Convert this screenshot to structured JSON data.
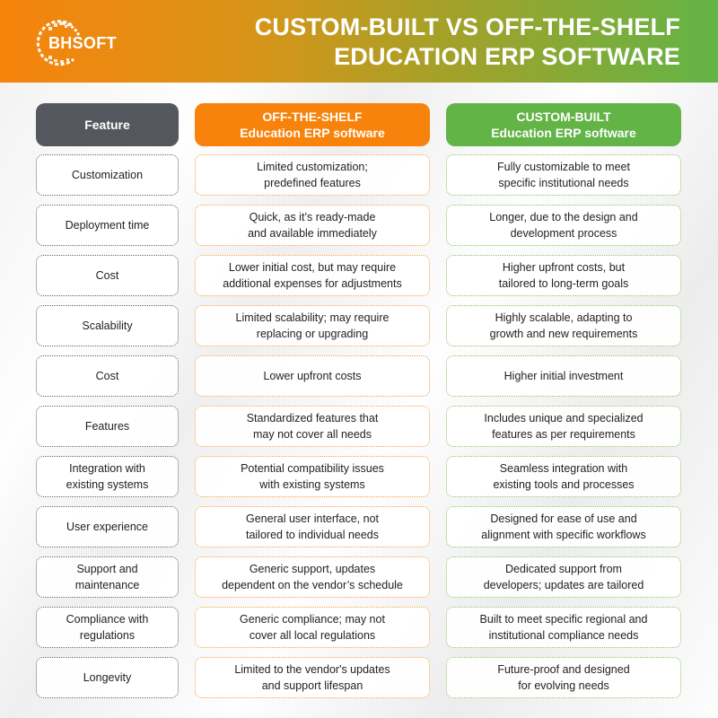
{
  "brand": {
    "logo_text": "BHSOFT",
    "logo_icon": "globe-icon"
  },
  "title": {
    "line1": "CUSTOM-BUILT VS OFF-THE-SHELF",
    "line2": "EDUCATION ERP SOFTWARE"
  },
  "colors": {
    "header_gradient_start": "#f7830c",
    "header_gradient_end": "#62b446",
    "feature_header": "#54575d",
    "off_the_shelf": "#f7830c",
    "custom_built": "#62b446"
  },
  "columns": {
    "feature": {
      "line1": "Feature",
      "line2": ""
    },
    "off_the_shelf": {
      "line1": "OFF-THE-SHELF",
      "line2": "Education ERP software"
    },
    "custom_built": {
      "line1": "CUSTOM-BUILT",
      "line2": "Education ERP software"
    }
  },
  "rows": [
    {
      "feature": [
        "Customization",
        ""
      ],
      "off_the_shelf": [
        "Limited customization;",
        "predefined features"
      ],
      "custom_built": [
        "Fully customizable to meet",
        "specific institutional needs"
      ]
    },
    {
      "feature": [
        "Deployment time",
        ""
      ],
      "off_the_shelf": [
        "Quick, as it’s ready-made",
        "and available immediately"
      ],
      "custom_built": [
        "Longer, due to the design and",
        "development process"
      ]
    },
    {
      "feature": [
        "Cost",
        ""
      ],
      "off_the_shelf": [
        "Lower initial cost, but may require",
        "additional expenses for adjustments"
      ],
      "custom_built": [
        "Higher upfront costs, but",
        "tailored to long-term goals"
      ]
    },
    {
      "feature": [
        "Scalability",
        ""
      ],
      "off_the_shelf": [
        "Limited scalability; may require",
        "replacing or upgrading"
      ],
      "custom_built": [
        "Highly scalable, adapting to",
        "growth and new requirements"
      ]
    },
    {
      "feature": [
        "Cost",
        ""
      ],
      "off_the_shelf": [
        "Lower upfront costs",
        ""
      ],
      "custom_built": [
        "Higher initial investment",
        ""
      ]
    },
    {
      "feature": [
        "Features",
        ""
      ],
      "off_the_shelf": [
        "Standardized features that",
        "may not cover all needs"
      ],
      "custom_built": [
        "Includes unique and specialized",
        "features as per requirements"
      ]
    },
    {
      "feature": [
        "Integration with",
        "existing systems"
      ],
      "off_the_shelf": [
        "Potential compatibility issues",
        "with existing systems"
      ],
      "custom_built": [
        "Seamless integration with",
        "existing tools and processes"
      ]
    },
    {
      "feature": [
        "User experience",
        ""
      ],
      "off_the_shelf": [
        "General user interface, not",
        "tailored to individual needs"
      ],
      "custom_built": [
        "Designed for ease of use and",
        "alignment with specific workflows"
      ]
    },
    {
      "feature": [
        "Support and",
        "maintenance"
      ],
      "off_the_shelf": [
        "Generic support, updates",
        "dependent on the vendor’s schedule"
      ],
      "custom_built": [
        "Dedicated support from",
        "developers; updates are tailored"
      ]
    },
    {
      "feature": [
        "Compliance with",
        "regulations"
      ],
      "off_the_shelf": [
        "Generic compliance; may not",
        "cover all local regulations"
      ],
      "custom_built": [
        "Built to meet specific regional and",
        "institutional compliance needs"
      ]
    },
    {
      "feature": [
        "Longevity",
        ""
      ],
      "off_the_shelf": [
        "Limited to the vendor's updates",
        "and support lifespan"
      ],
      "custom_built": [
        "Future-proof and designed",
        "for evolving needs"
      ]
    }
  ]
}
